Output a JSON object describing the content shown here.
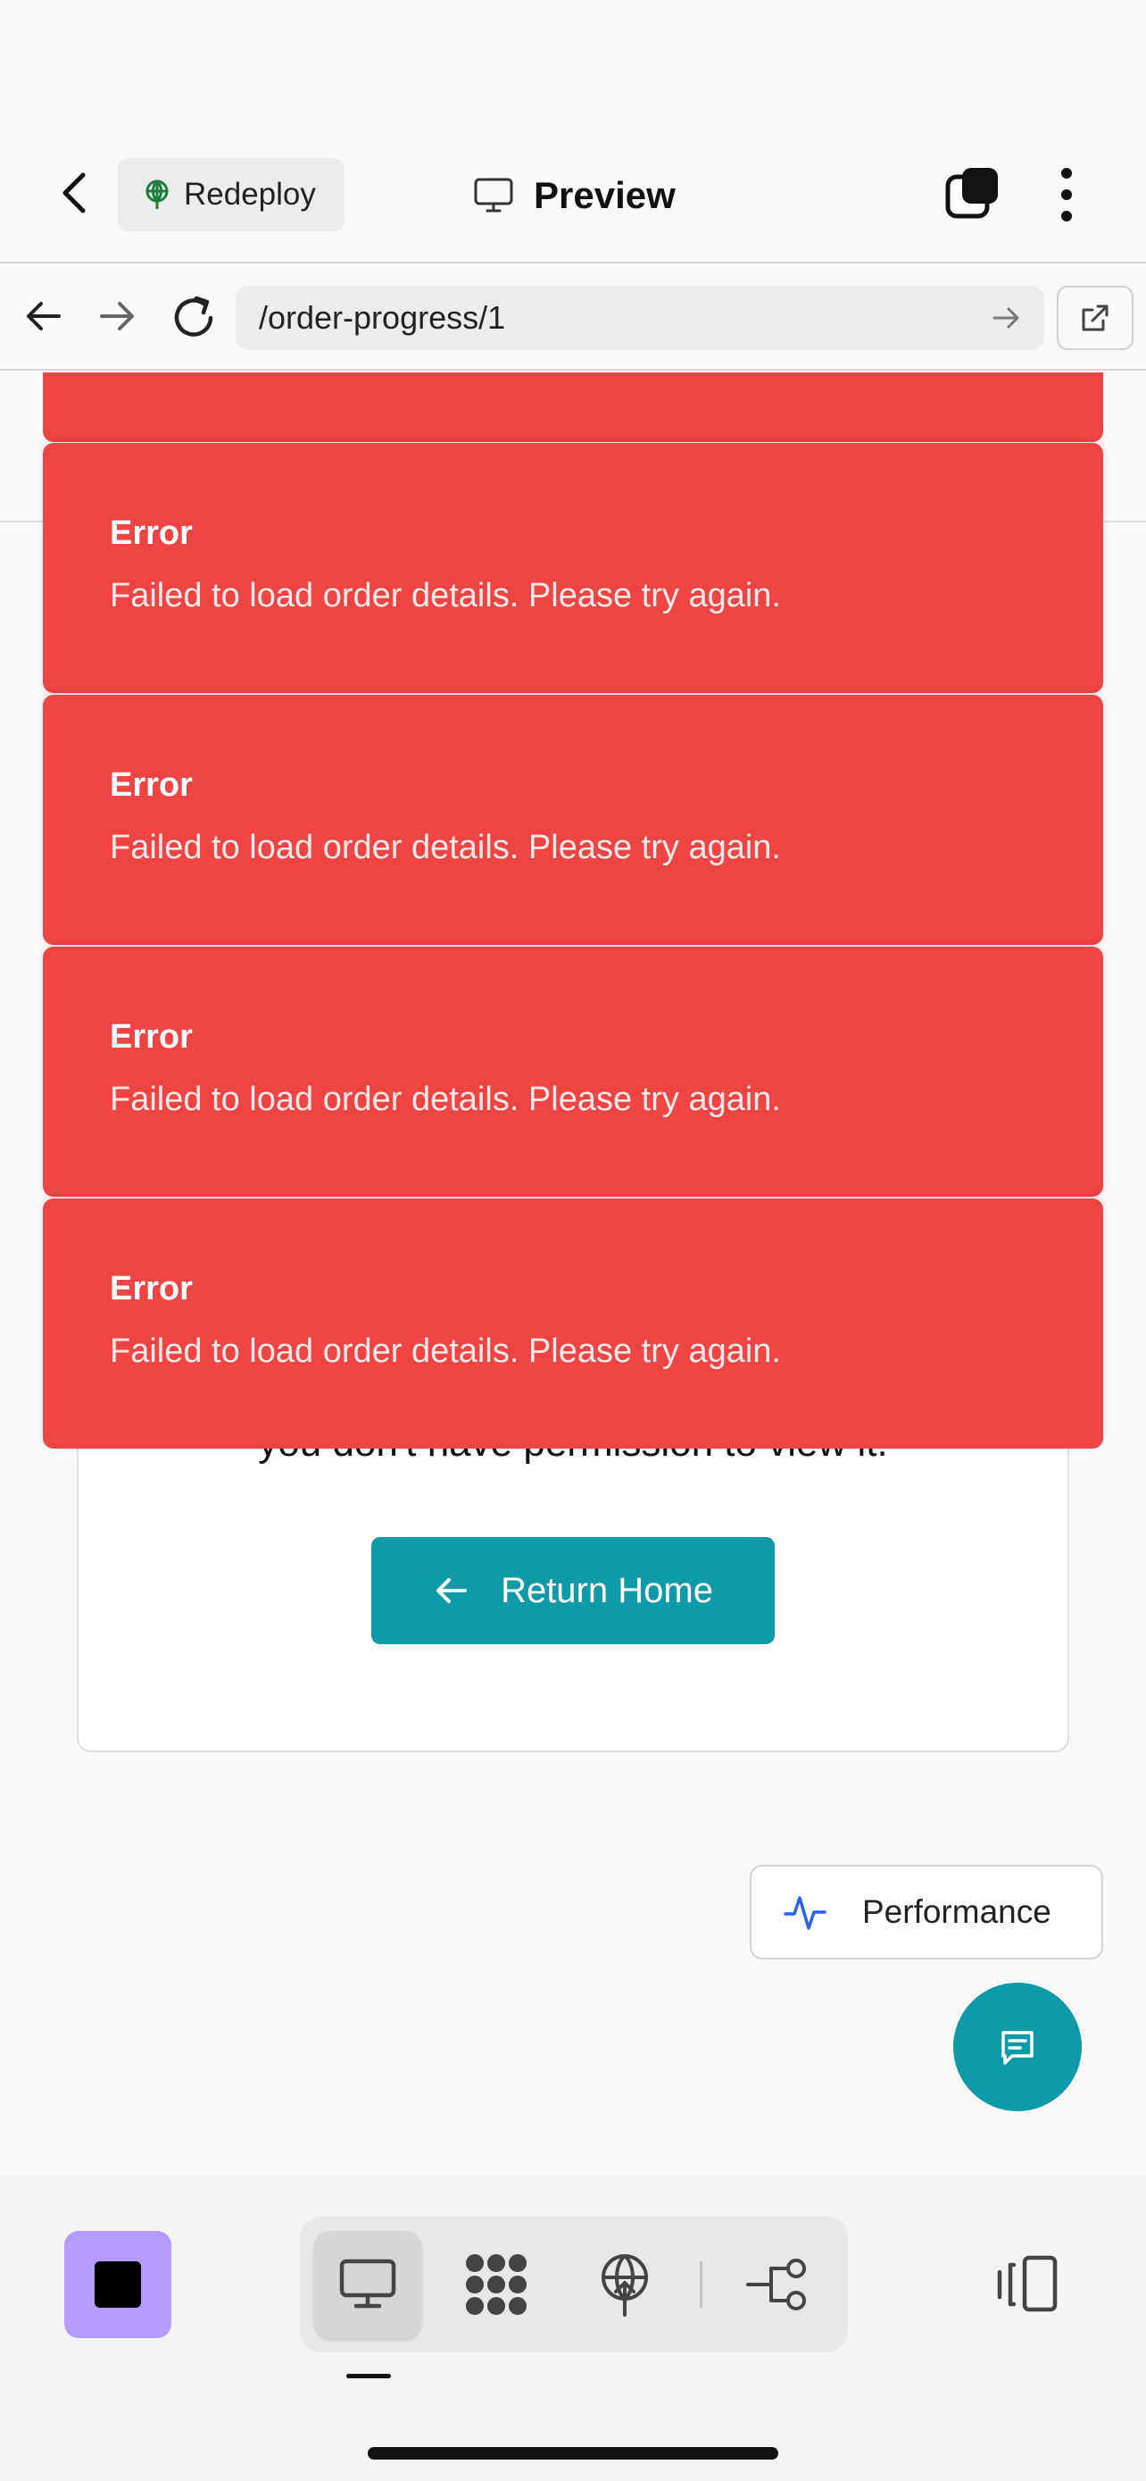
{
  "app_bar": {
    "redeploy_label": "Redeploy",
    "preview_label": "Preview",
    "icons": [
      "chevron-left-icon",
      "globe-icon",
      "monitor-icon",
      "tabs-icon",
      "more-vertical-icon"
    ]
  },
  "browser": {
    "url": "/order-progress/1",
    "icons": [
      "arrow-left-icon",
      "arrow-right-icon",
      "reload-icon",
      "go-arrow-icon",
      "external-link-icon"
    ]
  },
  "page": {
    "card_text": "you don't have permission to view it.",
    "return_label": "Return Home"
  },
  "toasts": [
    {
      "title": "Error",
      "message": "Failed to load order details. Please try again."
    },
    {
      "title": "Error",
      "message": "Failed to load order details. Please try again."
    },
    {
      "title": "Error",
      "message": "Failed to load order details. Please try again."
    },
    {
      "title": "Error",
      "message": "Failed to load order details. Please try again."
    }
  ],
  "performance_label": "Performance",
  "colors": {
    "toast": "#ef4444",
    "accent_teal": "#0e9aa7",
    "stop_purple": "#b49cff",
    "perf_icon_blue": "#2563eb"
  },
  "bottom_bar": {
    "items": [
      "desktop-icon",
      "grid-dots-icon",
      "globe-upload-icon",
      "workflow-icon"
    ],
    "active_index": 0
  }
}
